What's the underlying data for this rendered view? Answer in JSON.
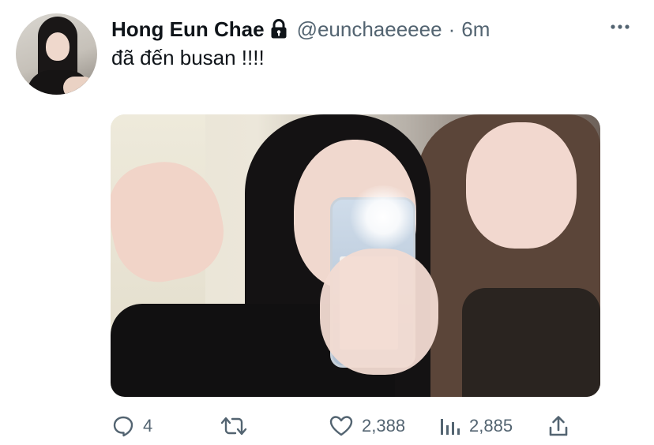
{
  "author": {
    "display_name": "Hong Eun Chae",
    "protected": true,
    "handle": "@eunchaeeeee",
    "separator": "·",
    "time": "6m"
  },
  "tweet": {
    "text": "đã đến busan !!!!"
  },
  "icons": {
    "lock": "lock-icon",
    "more": "more-icon",
    "reply": "reply-icon",
    "retweet": "retweet-icon",
    "like": "like-icon",
    "views": "views-icon",
    "share": "share-icon"
  },
  "actions": {
    "replies": "4",
    "retweets": "",
    "likes": "2,388",
    "views": "2,885"
  },
  "colors": {
    "text_primary": "#0f1419",
    "text_secondary": "#536471",
    "background": "#ffffff"
  }
}
